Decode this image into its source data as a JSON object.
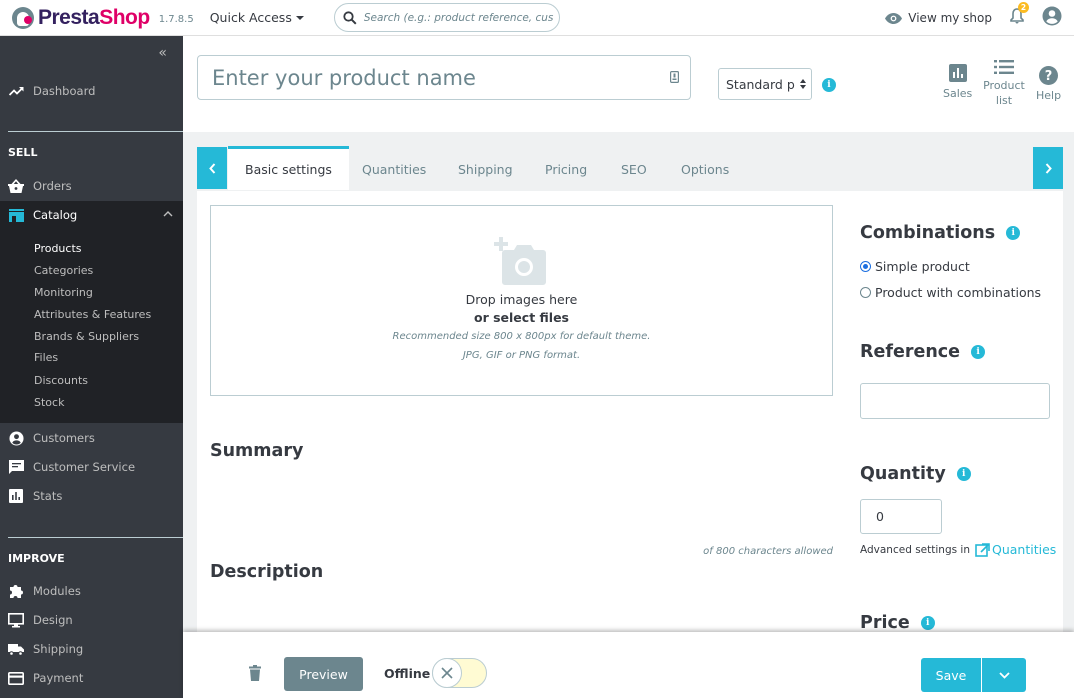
{
  "topbar": {
    "logo_part1": "Presta",
    "logo_part2": "Shop",
    "version": "1.7.8.5",
    "quick_access": "Quick Access",
    "search_placeholder": "Search (e.g.: product reference, custon",
    "view_shop": "View my shop",
    "notification_count": "2"
  },
  "sidebar": {
    "collapse_icon": "«",
    "dashboard": "Dashboard",
    "sections": {
      "sell": "SELL",
      "improve": "IMPROVE"
    },
    "sell_items": [
      {
        "label": "Orders",
        "icon": "basket-icon"
      },
      {
        "label": "Catalog",
        "icon": "store-icon",
        "active": true
      },
      {
        "label": "Customers",
        "icon": "account-circle-icon"
      },
      {
        "label": "Customer Service",
        "icon": "chat-icon"
      },
      {
        "label": "Stats",
        "icon": "bar-chart-icon"
      }
    ],
    "catalog_sub": [
      "Products",
      "Categories",
      "Monitoring",
      "Attributes & Features",
      "Brands & Suppliers",
      "Files",
      "Discounts",
      "Stock"
    ],
    "improve_items": [
      {
        "label": "Modules",
        "icon": "puzzle-icon"
      },
      {
        "label": "Design",
        "icon": "desktop-icon"
      },
      {
        "label": "Shipping",
        "icon": "truck-icon"
      },
      {
        "label": "Payment",
        "icon": "credit-card-icon"
      }
    ]
  },
  "header": {
    "product_name_placeholder": "Enter your product name",
    "product_type": "Standard p",
    "tools": [
      {
        "label": "Sales",
        "icon": "bar-chart-icon"
      },
      {
        "label": "Product list",
        "icon": "list-icon"
      },
      {
        "label": "Help",
        "icon": "help-icon"
      }
    ]
  },
  "tabs": [
    {
      "label": "Basic settings",
      "active": true
    },
    {
      "label": "Quantities"
    },
    {
      "label": "Shipping"
    },
    {
      "label": "Pricing"
    },
    {
      "label": "SEO"
    },
    {
      "label": "Options"
    }
  ],
  "dropzone": {
    "line1": "Drop images here",
    "line2": "or select files",
    "line3": "Recommended size 800 x 800px for default theme.",
    "line4": "JPG, GIF or PNG format."
  },
  "summary": {
    "title": "Summary",
    "char_info": "of 800 characters allowed"
  },
  "description": {
    "title": "Description"
  },
  "combinations": {
    "title": "Combinations",
    "options": [
      {
        "label": "Simple product",
        "checked": true
      },
      {
        "label": "Product with combinations",
        "checked": false
      }
    ]
  },
  "reference": {
    "title": "Reference",
    "value": ""
  },
  "quantity": {
    "title": "Quantity",
    "value": "0",
    "advanced_text": "Advanced settings in",
    "advanced_link": "Quantities"
  },
  "price": {
    "title": "Price"
  },
  "footer": {
    "preview": "Preview",
    "offline": "Offline",
    "online": false,
    "save": "Save"
  },
  "colors": {
    "accent": "#25b9d7",
    "sidebar_bg": "#363a41",
    "sidebar_active_bg": "#202226",
    "brand_pink": "#df0067",
    "brand_purple": "#34215f"
  }
}
